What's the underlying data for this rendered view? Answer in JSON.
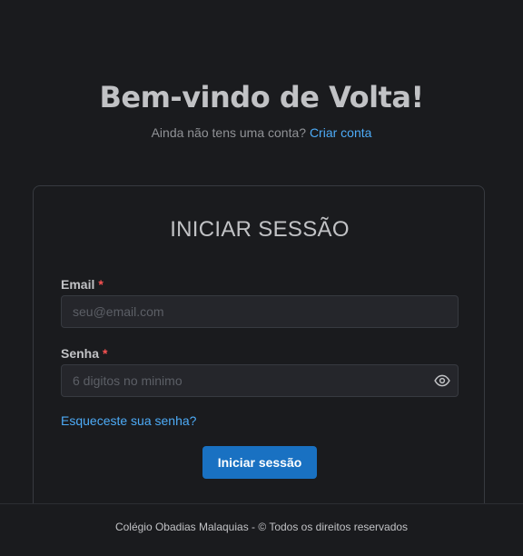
{
  "header": {
    "title": "Bem-vindo de Volta!",
    "signup_prompt": "Ainda não tens uma conta?",
    "signup_link": "Criar conta"
  },
  "login_card": {
    "title": "INICIAR SESSÃO",
    "email": {
      "label": "Email",
      "required_marker": "*",
      "placeholder": "seu@email.com",
      "value": ""
    },
    "password": {
      "label": "Senha",
      "required_marker": "*",
      "placeholder": "6 digitos no minimo",
      "value": "",
      "toggle_icon": "eye-icon"
    },
    "forgot_link": "Esqueceste sua senha?",
    "submit_label": "Iniciar sessão"
  },
  "footer": {
    "text": "Colégio Obadias Malaquias - © Todos os direitos reservados"
  },
  "colors": {
    "background": "#1a1b1e",
    "input_background": "#25262b",
    "border": "#373a40",
    "link": "#4dabf7",
    "primary_button": "#1971c2",
    "required": "#fa5252"
  }
}
